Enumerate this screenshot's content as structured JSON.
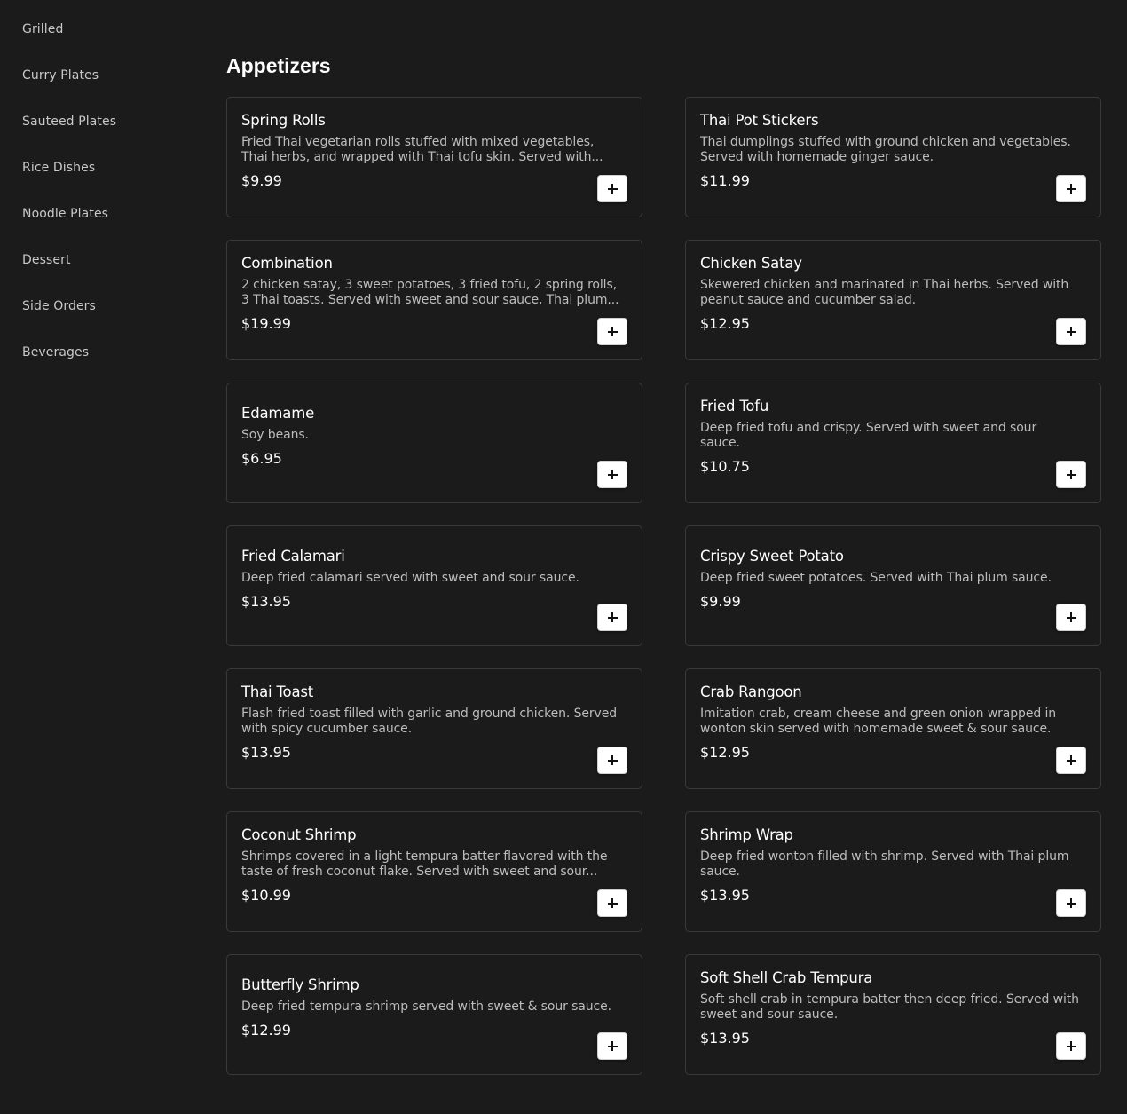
{
  "sidebar": {
    "items": [
      {
        "label": "Grilled"
      },
      {
        "label": "Curry Plates"
      },
      {
        "label": "Sauteed Plates"
      },
      {
        "label": "Rice Dishes"
      },
      {
        "label": "Noodle Plates"
      },
      {
        "label": "Dessert"
      },
      {
        "label": "Side Orders"
      },
      {
        "label": "Beverages"
      }
    ]
  },
  "section": {
    "title": "Appetizers"
  },
  "items": [
    {
      "name": "Spring Rolls",
      "description": "Fried Thai vegetarian rolls stuffed with mixed vegetables, Thai herbs, and wrapped with Thai tofu skin. Served with...",
      "price": "$9.99"
    },
    {
      "name": "Thai Pot Stickers",
      "description": "Thai dumplings stuffed with ground chicken and vegetables. Served with homemade ginger sauce.",
      "price": "$11.99"
    },
    {
      "name": "Combination",
      "description": "2 chicken satay, 3 sweet potatoes, 3 fried tofu, 2 spring rolls, 3 Thai toasts. Served with sweet and sour sauce, Thai plum...",
      "price": "$19.99"
    },
    {
      "name": "Chicken Satay",
      "description": "Skewered chicken and marinated in Thai herbs. Served with peanut sauce and cucumber salad.",
      "price": "$12.95"
    },
    {
      "name": "Edamame",
      "description": "Soy beans.",
      "price": "$6.95"
    },
    {
      "name": "Fried Tofu",
      "description": "Deep fried tofu and crispy. Served with sweet and sour sauce.",
      "price": "$10.75"
    },
    {
      "name": "Fried Calamari",
      "description": "Deep fried calamari served with sweet and sour sauce.",
      "price": "$13.95"
    },
    {
      "name": "Crispy Sweet Potato",
      "description": "Deep fried sweet potatoes. Served with Thai plum sauce.",
      "price": "$9.99"
    },
    {
      "name": "Thai Toast",
      "description": "Flash fried toast filled with garlic and ground chicken. Served with spicy cucumber sauce.",
      "price": "$13.95"
    },
    {
      "name": "Crab Rangoon",
      "description": "Imitation crab, cream cheese and green onion wrapped in wonton skin served with homemade sweet & sour sauce.",
      "price": "$12.95"
    },
    {
      "name": "Coconut Shrimp",
      "description": "Shrimps covered in a light tempura batter flavored with the taste of fresh coconut flake. Served with sweet and sour...",
      "price": "$10.99"
    },
    {
      "name": "Shrimp Wrap",
      "description": "Deep fried wonton filled with shrimp. Served with Thai plum sauce.",
      "price": "$13.95"
    },
    {
      "name": "Butterfly Shrimp",
      "description": "Deep fried tempura shrimp served with sweet & sour sauce.",
      "price": "$12.99"
    },
    {
      "name": "Soft Shell Crab Tempura",
      "description": "Soft shell crab in tempura batter then deep fried. Served with sweet and sour sauce.",
      "price": "$13.95"
    }
  ],
  "colors": {
    "background": "#1b1b1b",
    "card_border": "#3a3a3a",
    "text_primary": "#ffffff",
    "text_secondary": "#bdbdbd",
    "button_bg": "#ffffff"
  },
  "icons": {
    "add": "plus-icon"
  }
}
